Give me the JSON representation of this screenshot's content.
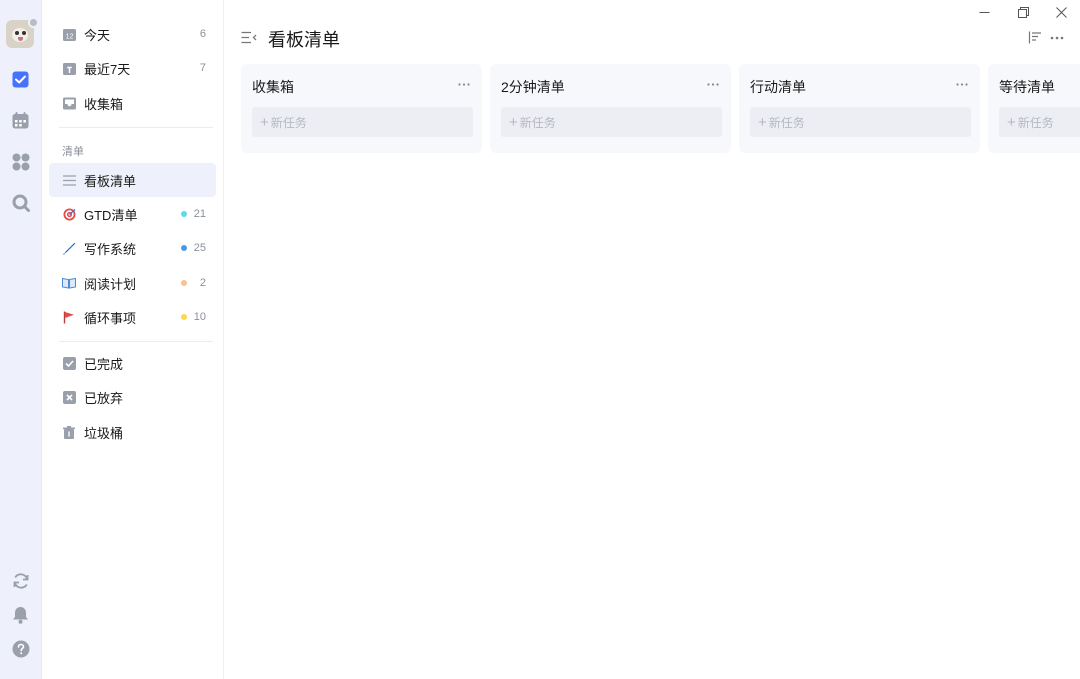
{
  "rail": {
    "icons": [
      "avatar",
      "task-checkbox-icon",
      "calendar-icon",
      "apps-grid-icon",
      "search-icon",
      "sync-icon",
      "bell-icon",
      "help-icon"
    ],
    "accent": "#4772fa",
    "icon_color": "#9aa0ab"
  },
  "sidebar": {
    "smart_lists": [
      {
        "label": "今天",
        "count": "6",
        "icon": "calendar-today-icon",
        "icon_text": "12"
      },
      {
        "label": "最近7天",
        "count": "7",
        "icon": "calendar-week-icon"
      },
      {
        "label": "收集箱",
        "count": "",
        "icon": "inbox-icon"
      }
    ],
    "section_title": "清单",
    "lists": [
      {
        "label": "看板清单",
        "count": "",
        "icon": "menu-list-icon",
        "active": true
      },
      {
        "label": "GTD清单",
        "count": "21",
        "icon": "target-icon",
        "dot": "#5fd8ea"
      },
      {
        "label": "写作系统",
        "count": "25",
        "icon": "pen-icon",
        "dot": "#4a9ae6"
      },
      {
        "label": "阅读计划",
        "count": "2",
        "icon": "book-icon",
        "dot": "#f7c28b"
      },
      {
        "label": "循环事项",
        "count": "10",
        "icon": "flag-icon",
        "dot": "#fbd94b"
      }
    ],
    "system_lists": [
      {
        "label": "已完成",
        "icon": "completed-icon"
      },
      {
        "label": "已放弃",
        "icon": "abandoned-icon"
      },
      {
        "label": "垃圾桶",
        "icon": "trash-icon"
      }
    ]
  },
  "main": {
    "title": "看板清单",
    "columns": [
      {
        "title": "收集箱",
        "add_placeholder": "新任务"
      },
      {
        "title": "2分钟清单",
        "add_placeholder": "新任务"
      },
      {
        "title": "行动清单",
        "add_placeholder": "新任务"
      },
      {
        "title": "等待清单",
        "add_placeholder": "新任务"
      }
    ]
  }
}
